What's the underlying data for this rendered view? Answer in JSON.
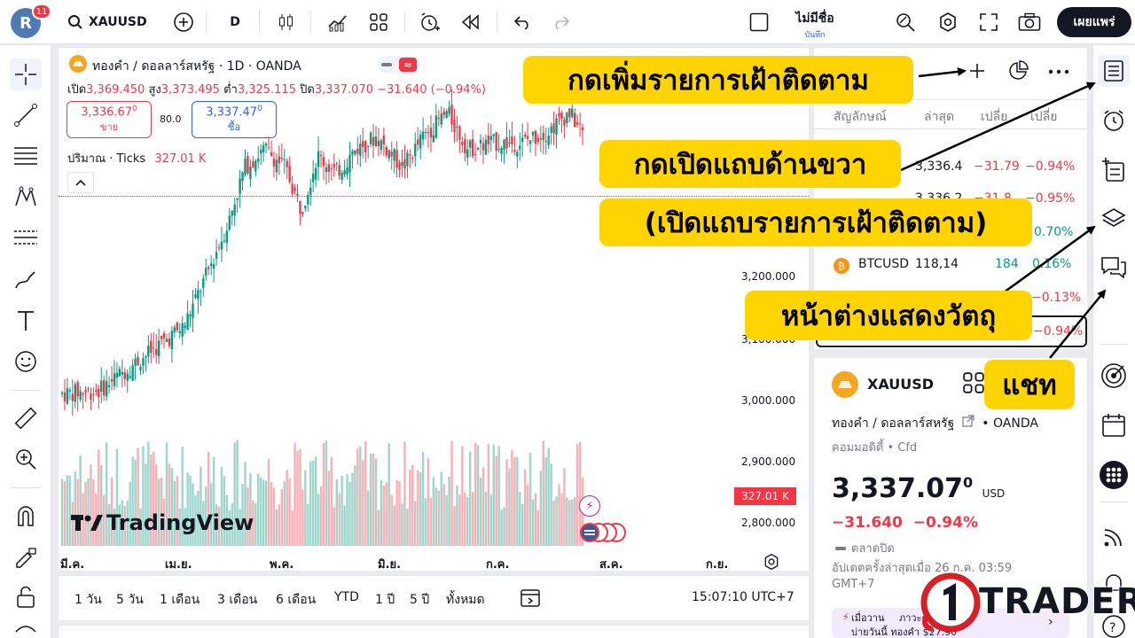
{
  "header": {
    "avatar_letter": "R",
    "notifications": "11",
    "symbol": "XAUUSD",
    "interval": "D",
    "unnamed": "ไม่มีชื่อ",
    "save": "บันทึก",
    "publish": "เผยแพร่"
  },
  "chart": {
    "title": "ทองคำ / ดอลลาร์สหรัฐ · 1D · OANDA",
    "ohlc": [
      {
        "label": "เปิด",
        "value": "3,369.450"
      },
      {
        "label": "สูง",
        "value": "3,373.495"
      },
      {
        "label": "ต่ำ",
        "value": "3,325.115"
      },
      {
        "label": "ปิด",
        "value": "3,337.070"
      }
    ],
    "change": "−31.640 (−0.94%)",
    "sell_price": "3,336.67",
    "sell_sup": "0",
    "sell_label": "ขาย",
    "spread": "80.0",
    "buy_price": "3,337.47",
    "buy_sup": "0",
    "buy_label": "ซื้อ",
    "volume_label": "ปริมาณ · Ticks",
    "volume_value": "327.01 K",
    "volume_tag": "327.01 K",
    "brand": "TradingView",
    "y_labels": [
      "3,200.000",
      "3,100.000",
      "3,000.000",
      "2,900.000",
      "2,800.000"
    ],
    "x_labels": [
      "มี.ค.",
      "เม.ย.",
      "พ.ค.",
      "มิ.ย.",
      "ก.ค.",
      "ส.ค.",
      "ก.ย."
    ]
  },
  "timeframes": [
    "1 วัน",
    "5 วัน",
    "1 เดือน",
    "3 เดือน",
    "6 เดือน",
    "YTD",
    "1 ปี",
    "5 ปี",
    "ทั้งหมด"
  ],
  "clock": "15:07:10 UTC+7",
  "watchlist": {
    "headers": [
      "สัญลักษณ์",
      "ล่าสุด",
      "เปลี่ย",
      "เปลี่ย"
    ],
    "rows": [
      {
        "last": "3,336.4",
        "chg": "−31.79",
        "pct": "−0.94%",
        "color": "#f23645"
      },
      {
        "last": "3,336.2",
        "chg": "−31.8",
        "pct": "−0.95%",
        "color": "#f23645"
      },
      {
        "last": "",
        "chg": "",
        "pct": "0.70%",
        "color": "#089981"
      },
      {
        "symbol": "BTCUSD",
        "last": "118,14",
        "chg": "184",
        "pct": "0.16%",
        "color": "#089981"
      },
      {
        "last": "",
        "chg": "",
        "pct": "−0.13%",
        "color": "#f23645"
      },
      {
        "last": "",
        "chg": "",
        "pct": "−0.94%",
        "color": "#f23645"
      }
    ]
  },
  "details": {
    "symbol": "XAUUSD",
    "name": "ทองคำ / ดอลลาร์สหรัฐ",
    "exchange": "OANDA",
    "category": "คอมมอดิตี้ • Cfd",
    "price": "3,337.07",
    "price_sup": "0",
    "currency": "USD",
    "change": "−31.640",
    "change_pct": "−0.94%",
    "market_status": "ตลาดปิด",
    "updated": "อัปเดตครั้งล่าสุดเมื่อ 26 ก.ค. 03:59",
    "tz": "GMT+7",
    "news_prefix": "เมื่อวาน",
    "news_text": "ภาวะตลาดทองคำ",
    "news_text2": "บ่ายวันนี้ ทองคำ $27.90"
  },
  "callouts": {
    "add_watchlist": "กดเพิ่มรายการเฝ้าติดตาม",
    "open_right_1": "กดเปิดแถบด้านขวา",
    "open_right_2": "(เปิดแถบรายการเฝ้าติดตาม)",
    "object_tree": "หน้าต่างแสดงวัตถุ",
    "chat": "แชท"
  },
  "logo": "TRADER",
  "colors": {
    "up": "#089981",
    "down": "#f23645",
    "callout": "#ffd400",
    "accent": "#2962ff"
  }
}
